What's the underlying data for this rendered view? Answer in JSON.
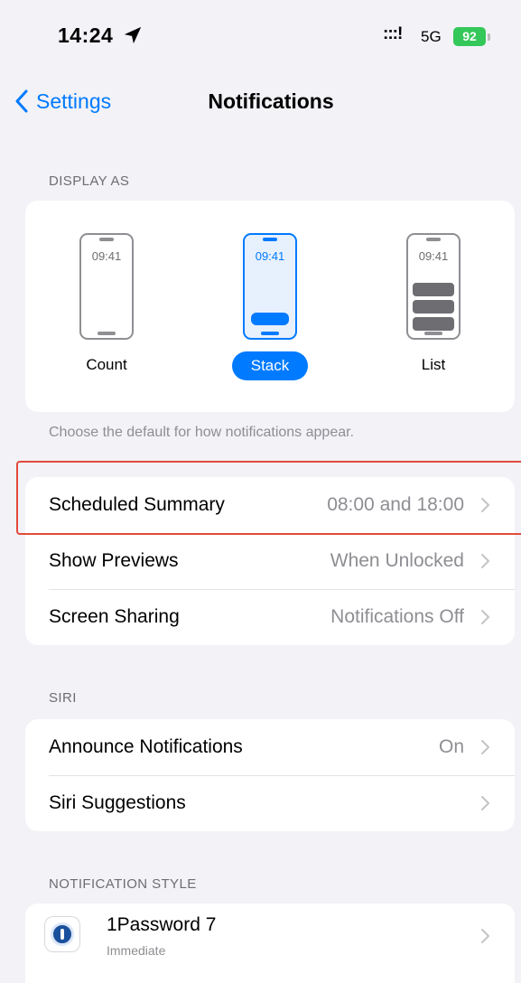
{
  "status_bar": {
    "time": "14:24",
    "signal": ":::!",
    "network": "5G",
    "battery": "92"
  },
  "nav": {
    "back_label": "Settings",
    "title": "Notifications"
  },
  "display_as": {
    "header": "DISPLAY AS",
    "options": [
      {
        "label": "Count",
        "clock": "09:41",
        "selected": false
      },
      {
        "label": "Stack",
        "clock": "09:41",
        "selected": true
      },
      {
        "label": "List",
        "clock": "09:41",
        "selected": false
      }
    ],
    "footer": "Choose the default for how notifications appear."
  },
  "settings_rows": [
    {
      "label": "Scheduled Summary",
      "value": "08:00 and 18:00"
    },
    {
      "label": "Show Previews",
      "value": "When Unlocked"
    },
    {
      "label": "Screen Sharing",
      "value": "Notifications Off"
    }
  ],
  "siri": {
    "header": "SIRI",
    "rows": [
      {
        "label": "Announce Notifications",
        "value": "On"
      },
      {
        "label": "Siri Suggestions",
        "value": ""
      }
    ]
  },
  "notification_style": {
    "header": "NOTIFICATION STYLE",
    "apps": [
      {
        "name": "1Password 7",
        "subtitle": "Immediate",
        "icon": "1password-icon"
      }
    ]
  },
  "colors": {
    "accent": "#007aff",
    "background": "#f2f2f7",
    "highlight": "#e24a3b",
    "battery": "#34c759"
  }
}
